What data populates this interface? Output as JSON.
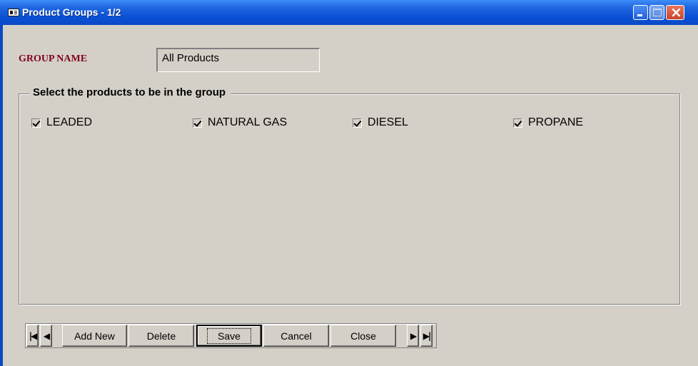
{
  "window": {
    "title": "Product Groups - 1/2",
    "icon": "form-icon",
    "controls": [
      "minimize-icon",
      "maximize-icon",
      "close-icon"
    ],
    "colors": {
      "titlebar": "#0b49c4",
      "body": "#d4d0c8",
      "label": "#80001a"
    }
  },
  "form": {
    "group_name_label": "GROUP NAME",
    "group_name_value": "All Products"
  },
  "products": {
    "legend": "Select the products to be in the group",
    "items": [
      {
        "label": "LEADED",
        "checked": true
      },
      {
        "label": "NATURAL GAS",
        "checked": true
      },
      {
        "label": "DIESEL",
        "checked": true
      },
      {
        "label": "PROPANE",
        "checked": true
      }
    ]
  },
  "toolbar": {
    "first_icon": "first-record-icon",
    "prev_icon": "previous-record-icon",
    "add_new": "Add New",
    "delete": "Delete",
    "save": "Save",
    "cancel": "Cancel",
    "close": "Close",
    "next_icon": "next-record-icon",
    "last_icon": "last-record-icon"
  }
}
